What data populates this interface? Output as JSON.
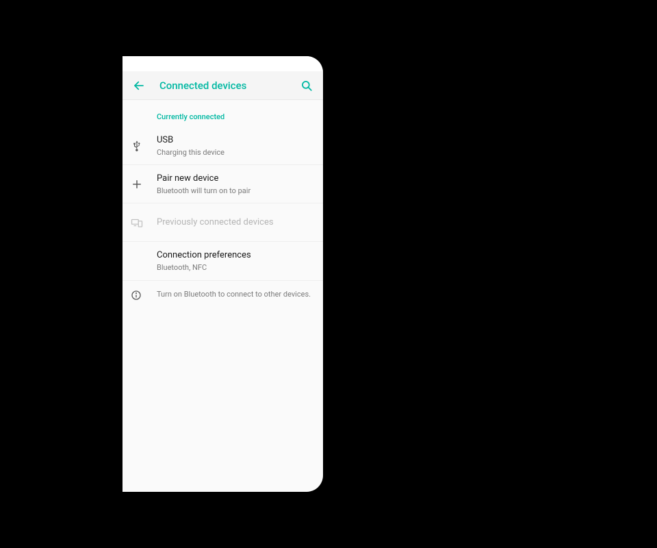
{
  "appbar": {
    "title": "Connected devices"
  },
  "section_header": "Currently connected",
  "items": {
    "usb": {
      "title": "USB",
      "subtitle": "Charging this device"
    },
    "pair": {
      "title": "Pair new device",
      "subtitle": "Bluetooth will turn on to pair"
    },
    "previous": {
      "title": "Previously connected devices"
    },
    "prefs": {
      "title": "Connection preferences",
      "subtitle": "Bluetooth, NFC"
    }
  },
  "hint": "Turn on Bluetooth to connect to other devices."
}
